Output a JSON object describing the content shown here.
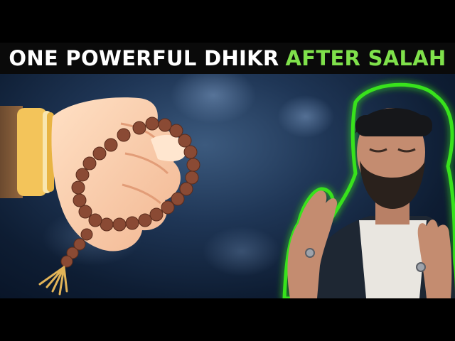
{
  "title": {
    "part1": "ONE POWERFUL DHIKR",
    "part2": "AFTER SALAH",
    "part1_color": "#ffffff",
    "part2_color": "#7fe14b"
  },
  "scene": {
    "left_figure": "cartoon-hand-holding-prayer-beads",
    "right_figure": "man-praying-with-raised-hands",
    "glow_color": "#39e21c"
  }
}
